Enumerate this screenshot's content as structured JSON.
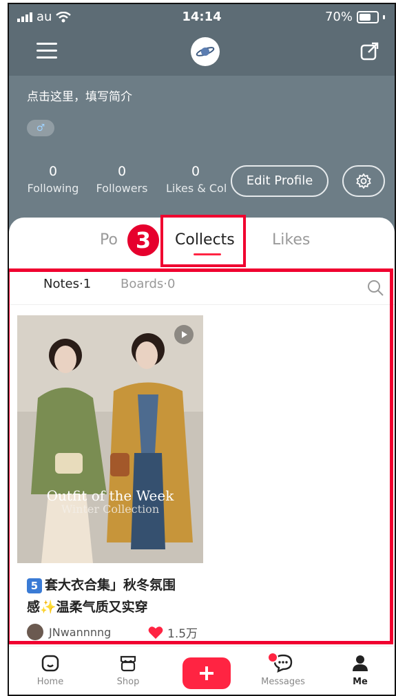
{
  "status_bar": {
    "carrier": "au",
    "time": "14:14",
    "battery": "70%"
  },
  "profile": {
    "bio_placeholder": "点击这里，填写简介",
    "gender_symbol": "♂",
    "stats": [
      {
        "value": "0",
        "label": "Following"
      },
      {
        "value": "0",
        "label": "Followers"
      },
      {
        "value": "0",
        "label": "Likes & Col"
      }
    ],
    "edit_profile_label": "Edit Profile"
  },
  "tabs": {
    "posts": "Po",
    "collects": "Collects",
    "likes": "Likes",
    "step_badge": "3"
  },
  "subtabs": {
    "notes": "Notes·1",
    "boards": "Boards·0"
  },
  "card": {
    "overlay_title": "Outfit of the Week",
    "overlay_subtitle": "Winter Collection",
    "title_number": "5",
    "title_part1": "套大衣合集」秋冬氛围",
    "title_part2": "感✨温柔气质又实穿",
    "author": "JNwannnng",
    "likes": "1.5万"
  },
  "bottom_nav": {
    "home": "Home",
    "shop": "Shop",
    "messages": "Messages",
    "me": "Me"
  },
  "colors": {
    "accent": "#ff2442",
    "header": "#6d7d86",
    "highlight": "#f0002f"
  }
}
